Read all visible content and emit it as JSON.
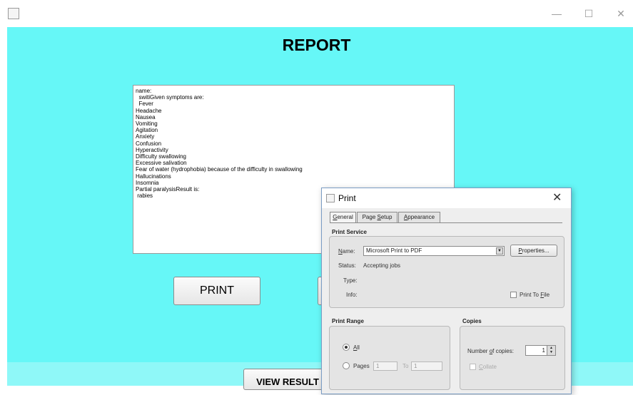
{
  "window": {
    "app_icon": "java-coffee-cup-icon",
    "controls": {
      "minimize": "—",
      "maximize": "☐",
      "close": "✕"
    }
  },
  "report": {
    "title": "REPORT",
    "content": "name:\n  switiGiven symptoms are:\n  Fever\nHeadache\nNausea\nVomiting\nAgitation\nAnxiety\nConfusion\nHyperactivity\nDifficulty swallowing\nExcessive salivation\nFear of water (hydrophobia) because of the difficulty in swallowing\nHallucinations\nInsomnia\nPartial paralysisResult is:\n rabies"
  },
  "buttons": {
    "print": "PRINT",
    "view_result": "VIEW RESULT"
  },
  "print_dialog": {
    "title": "Print",
    "close": "✕",
    "tabs": [
      {
        "label": "General",
        "mnemonic": "G",
        "rest": "eneral",
        "active": true
      },
      {
        "label": "Page Setup",
        "pre": "Page ",
        "mnemonic": "S",
        "rest": "etup",
        "active": false
      },
      {
        "label": "Appearance",
        "mnemonic": "A",
        "rest": "ppearance",
        "active": false
      }
    ],
    "print_service": {
      "section": "Print Service",
      "name_label_m": "N",
      "name_label_rest": "ame:",
      "name_value": "Microsoft Print to PDF",
      "properties_m": "P",
      "properties_rest": "roperties...",
      "status_label": "Status:",
      "status_value": "Accepting jobs",
      "type_label": "Type:",
      "info_label": "Info:",
      "print_to_file_pre": "Print To ",
      "print_to_file_m": "F",
      "print_to_file_rest": "ile",
      "print_to_file_checked": false
    },
    "print_range": {
      "section": "Print Range",
      "all_m": "A",
      "all_rest": "ll",
      "pages_pre": "Pa",
      "pages_m": "g",
      "pages_rest": "es",
      "from_value": "1",
      "to_label": "To",
      "to_value": "1",
      "selected": "All"
    },
    "copies": {
      "section": "Copies",
      "number_pre": "Number ",
      "number_m": "o",
      "number_rest": "f copies:",
      "value": "1",
      "collate_m": "C",
      "collate_rest": "ollate",
      "collate_enabled": false
    }
  },
  "colors": {
    "background": "#66f7f7",
    "lower_panel": "#8ff8f8",
    "dialog_border": "#7a9cc4"
  }
}
